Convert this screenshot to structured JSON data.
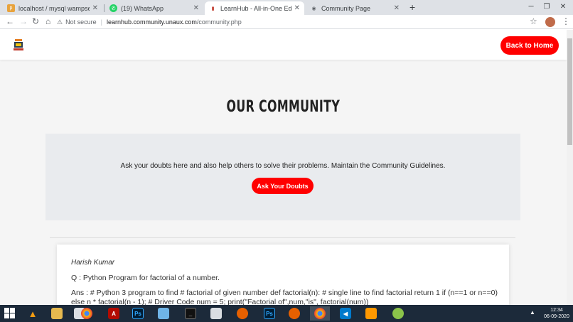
{
  "browser": {
    "tabs": [
      {
        "title": "localhost / mysql wampserver / l...",
        "icon": "phpmyadmin-icon",
        "active": false
      },
      {
        "title": "(19) WhatsApp",
        "icon": "whatsapp-icon",
        "active": false
      },
      {
        "title": "LearnHub - All-in-One Educatio...",
        "icon": "learnhub-icon",
        "active": true
      },
      {
        "title": "Community Page",
        "icon": "globe-icon",
        "active": false
      }
    ],
    "new_tab_label": "+",
    "security_label": "Not secure",
    "url_host": "learnhub.community.unaux.com",
    "url_path": "/community.php"
  },
  "site": {
    "back_button": "Back to Home",
    "heading": "OUR COMMUNITY",
    "ask_text": "Ask your doubts here and also help others to solve their problems. Maintain the Community Guidelines.",
    "ask_button": "Ask Your Doubts",
    "posts": [
      {
        "author": "Harish Kumar",
        "question": "Q : Python Program for factorial of a number.",
        "answer": "Ans : # Python 3 program to find # factorial of given number def factorial(n): # single line to find factorial return 1 if (n==1 or n==0) else n * factorial(n - 1); # Driver Code num = 5; print(\"Factorial of\",num,\"is\", factorial(num))"
      }
    ]
  },
  "taskbar": {
    "time": "12:34",
    "date": "06-09-2020"
  },
  "colors": {
    "accent": "#ff0000",
    "panel": "#e9ebee",
    "taskbar": "#1c2a3a"
  }
}
